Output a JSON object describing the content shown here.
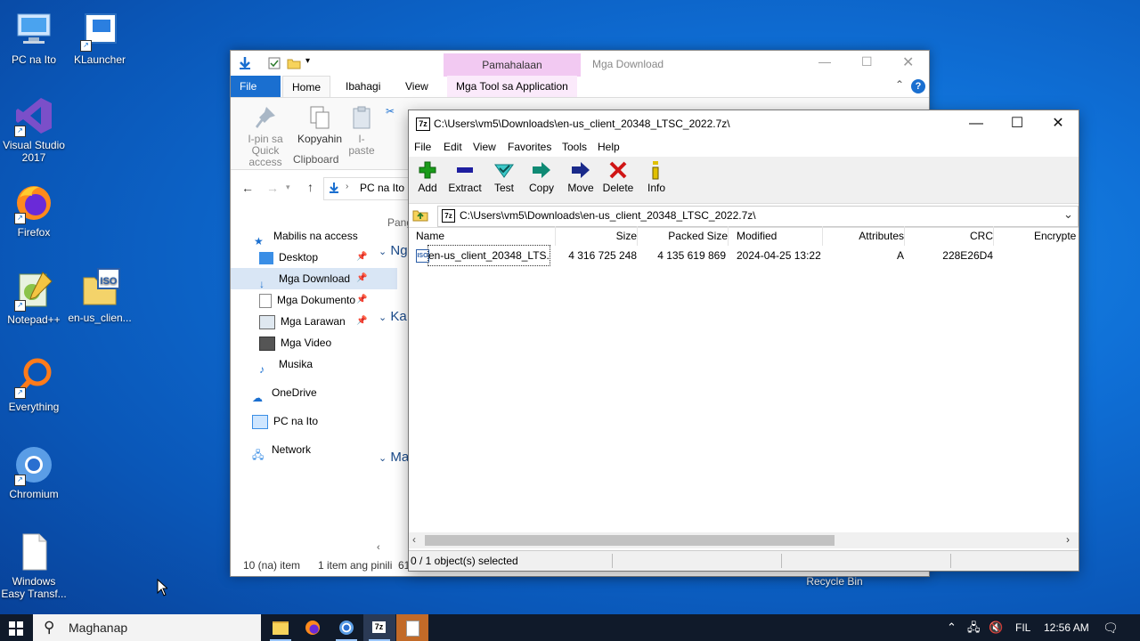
{
  "desktop": {
    "icons": [
      {
        "label": "PC na Ito"
      },
      {
        "label": "KLauncher"
      },
      {
        "label": "Visual Studio 2017"
      },
      {
        "label": "Firefox"
      },
      {
        "label": "Notepad++"
      },
      {
        "label": "en-us_clien..."
      },
      {
        "label": "Everything"
      },
      {
        "label": "Chromium"
      },
      {
        "label": "Windows Easy Transf..."
      },
      {
        "label": "Recycle Bin"
      }
    ]
  },
  "explorer": {
    "title": "Mga Download",
    "context_tab": "Pamahalaan",
    "tabs": [
      "File",
      "Home",
      "Ibahagi",
      "View",
      "Mga Tool sa Application"
    ],
    "ribbon": {
      "pin_label": "I-pin sa Quick access",
      "copy_label": "Kopyahin",
      "paste_label": "I-paste",
      "group_label": "Clipboard"
    },
    "nav_path": "PC na Ito",
    "sidebar": [
      {
        "label": "Mabilis na access"
      },
      {
        "label": "Desktop"
      },
      {
        "label": "Mga Download"
      },
      {
        "label": "Mga Dokumento"
      },
      {
        "label": "Mga Larawan"
      },
      {
        "label": "Mga Video"
      },
      {
        "label": "Musika"
      },
      {
        "label": "OneDrive"
      },
      {
        "label": "PC na Ito"
      },
      {
        "label": "Network"
      }
    ],
    "content_fragments": {
      "pane_header": "Pang",
      "group1": "Ng",
      "group2": "Ka",
      "group3": "Ma"
    },
    "status": {
      "item_count": "10 (na) item",
      "selected": "1 item ang pinili",
      "extra": "61"
    }
  },
  "zip": {
    "title": "C:\\Users\\vm5\\Downloads\\en-us_client_20348_LTSC_2022.7z\\",
    "menu": [
      "File",
      "Edit",
      "View",
      "Favorites",
      "Tools",
      "Help"
    ],
    "toolbar": [
      {
        "label": "Add",
        "icon": "plus-icon",
        "color": "#1a9b1a"
      },
      {
        "label": "Extract",
        "icon": "minus-icon",
        "color": "#1e1ea0"
      },
      {
        "label": "Test",
        "icon": "check-icon",
        "color": "#16a8a8"
      },
      {
        "label": "Copy",
        "icon": "arrow-right-icon",
        "color": "#0f8a74"
      },
      {
        "label": "Move",
        "icon": "arrow-right-icon",
        "color": "#1a2a8a"
      },
      {
        "label": "Delete",
        "icon": "x-icon",
        "color": "#d01515"
      },
      {
        "label": "Info",
        "icon": "info-icon",
        "color": "#c8a800"
      }
    ],
    "address": "C:\\Users\\vm5\\Downloads\\en-us_client_20348_LTSC_2022.7z\\",
    "columns": [
      "Name",
      "Size",
      "Packed Size",
      "Modified",
      "Attributes",
      "CRC",
      "Encrypte"
    ],
    "rows": [
      {
        "name": "en-us_client_20348_LTS...",
        "size": "4 316 725 248",
        "packed": "4 135 619 869",
        "modified": "2024-04-25 13:22",
        "attributes": "A",
        "crc": "228E26D4",
        "encrypted": ""
      }
    ],
    "status": "0 / 1 object(s) selected"
  },
  "taskbar": {
    "search_placeholder": "Maghanap",
    "lang": "FIL",
    "time": "12:56 AM"
  }
}
